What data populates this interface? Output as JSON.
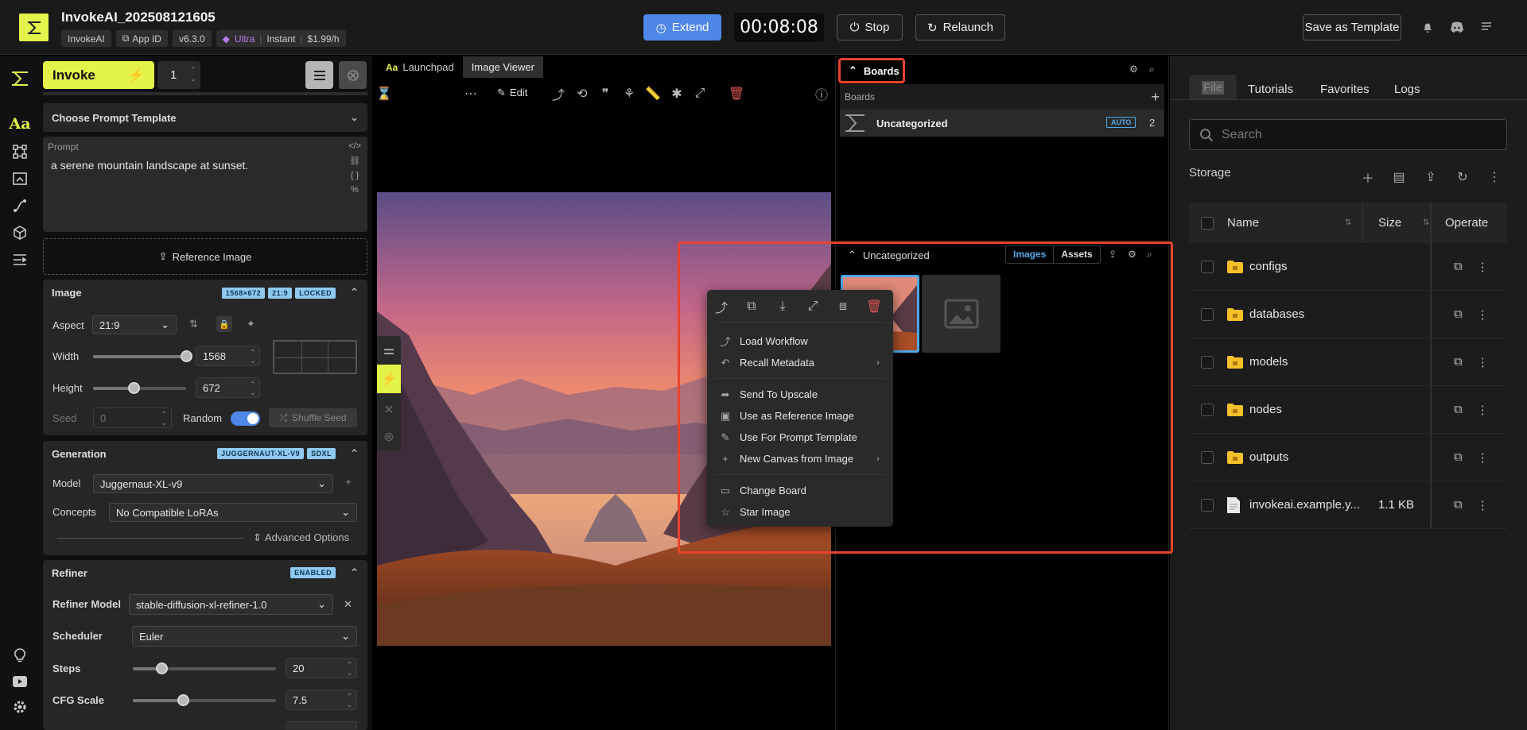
{
  "header": {
    "title": "InvokeAI_202508121605",
    "chips": [
      "InvokeAI",
      "App ID",
      "v6.3.0"
    ],
    "plan": {
      "tier": "Ultra",
      "mode": "Instant",
      "price": "$1.99/h"
    },
    "extend_label": "Extend",
    "timer": "00:08:08",
    "stop_label": "Stop",
    "relaunch_label": "Relaunch",
    "save_template_label": "Save as Template",
    "icons": [
      "bell-icon",
      "discord-icon",
      "list-icon"
    ]
  },
  "rail": {
    "icons": [
      "invoke-logo-icon",
      "text-prompt-icon",
      "workflow-nodes-icon",
      "canvas-icon",
      "upscale-icon",
      "models-cube-icon",
      "queue-list-icon",
      "lightbulb-icon",
      "youtube-icon",
      "settings-icon"
    ]
  },
  "left_panel": {
    "invoke_label": "Invoke",
    "quantity": "1",
    "prompt_template": "Choose Prompt Template",
    "prompt_label": "Prompt",
    "prompt_text": "a serene mountain landscape at sunset.",
    "reference_image_label": "Reference Image",
    "image": {
      "title": "Image",
      "badges": [
        "1568×672",
        "21:9",
        "LOCKED"
      ],
      "aspect_label": "Aspect",
      "aspect_value": "21:9",
      "width_label": "Width",
      "width_value": "1568",
      "width_fraction": 1.0,
      "height_label": "Height",
      "height_value": "672",
      "height_fraction": 0.44,
      "seed_label": "Seed",
      "seed_value": "0",
      "random_label": "Random",
      "random_on": true,
      "shuffle_label": "Shuffle Seed"
    },
    "generation": {
      "title": "Generation",
      "badges": [
        "JUGGERNAUT-XL-V9",
        "SDXL"
      ],
      "model_label": "Model",
      "model_value": "Juggernaut-XL-v9",
      "concepts_label": "Concepts",
      "concepts_value": "No Compatible LoRAs",
      "advanced_label": "Advanced Options"
    },
    "refiner": {
      "title": "Refiner",
      "badge": "ENABLED",
      "model_label": "Refiner Model",
      "model_value": "stable-diffusion-xl-refiner-1.0",
      "scheduler_label": "Scheduler",
      "scheduler_value": "Euler",
      "steps_label": "Steps",
      "steps_value": "20",
      "steps_fraction": 0.2,
      "cfg_label": "CFG Scale",
      "cfg_value": "7.5",
      "cfg_fraction": 0.35
    }
  },
  "viewer": {
    "tabs": [
      {
        "label": "Launchpad",
        "icon": "Aa"
      },
      {
        "label": "Image Viewer"
      }
    ],
    "edit_label": "Edit"
  },
  "boards": {
    "header": "Boards",
    "section_label": "Boards",
    "board_name": "Uncategorized",
    "board_badge": "AUTO",
    "board_count": "2",
    "gallery_title": "Uncategorized",
    "gallery_tabs": [
      "Images",
      "Assets"
    ]
  },
  "context_menu": {
    "items": [
      {
        "label": "Load Workflow",
        "icon": "workflow-icon"
      },
      {
        "label": "Recall Metadata",
        "icon": "recall-icon",
        "submenu": true
      },
      {
        "label": "Send To Upscale",
        "icon": "share-icon"
      },
      {
        "label": "Use as Reference Image",
        "icon": "image-icon"
      },
      {
        "label": "Use For Prompt Template",
        "icon": "paint-brush-icon"
      },
      {
        "label": "New Canvas from Image",
        "icon": "plus-icon",
        "submenu": true
      },
      {
        "label": "Change Board",
        "icon": "folder-icon"
      },
      {
        "label": "Star Image",
        "icon": "star-icon"
      }
    ]
  },
  "file_panel": {
    "tabs": [
      "File",
      "Tutorials",
      "Favorites",
      "Logs"
    ],
    "search_placeholder": "Search",
    "storage_label": "Storage",
    "columns": [
      "Name",
      "Size",
      "Operate"
    ],
    "files": [
      {
        "name": "configs",
        "size": "",
        "type": "folder"
      },
      {
        "name": "databases",
        "size": "",
        "type": "folder"
      },
      {
        "name": "models",
        "size": "",
        "type": "folder"
      },
      {
        "name": "nodes",
        "size": "",
        "type": "folder"
      },
      {
        "name": "outputs",
        "size": "",
        "type": "folder"
      },
      {
        "name": "invokeai.example.y...",
        "size": "1.1 KB",
        "type": "file"
      }
    ]
  },
  "colors": {
    "accent": "#e4f34a",
    "blue": "#4f87e8",
    "highlight": "#e8432d",
    "badge": "#8fc9ef"
  }
}
